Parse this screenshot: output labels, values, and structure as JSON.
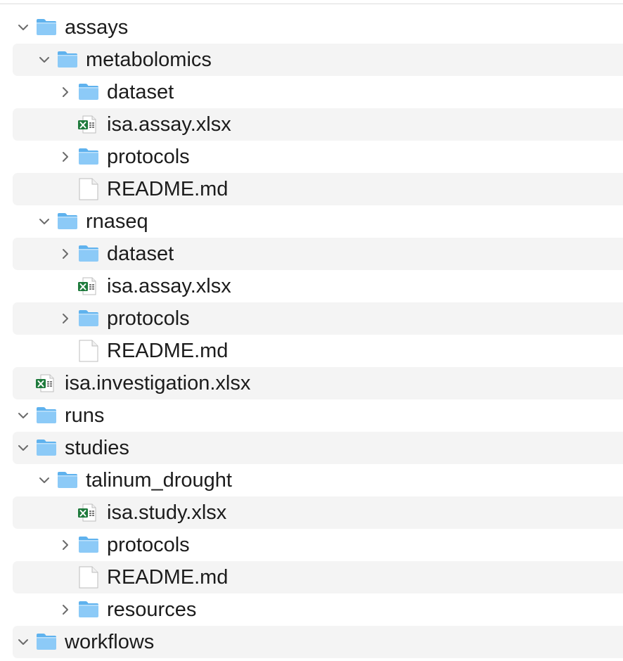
{
  "tree": {
    "rows": [
      {
        "label": "assays",
        "kind": "folder",
        "depth": 0,
        "expanded": true
      },
      {
        "label": "metabolomics",
        "kind": "folder",
        "depth": 1,
        "expanded": true
      },
      {
        "label": "dataset",
        "kind": "folder",
        "depth": 2,
        "expanded": false
      },
      {
        "label": "isa.assay.xlsx",
        "kind": "excel",
        "depth": 2
      },
      {
        "label": "protocols",
        "kind": "folder",
        "depth": 2,
        "expanded": false
      },
      {
        "label": "README.md",
        "kind": "file",
        "depth": 2
      },
      {
        "label": "rnaseq",
        "kind": "folder",
        "depth": 1,
        "expanded": true
      },
      {
        "label": "dataset",
        "kind": "folder",
        "depth": 2,
        "expanded": false
      },
      {
        "label": "isa.assay.xlsx",
        "kind": "excel",
        "depth": 2
      },
      {
        "label": "protocols",
        "kind": "folder",
        "depth": 2,
        "expanded": false
      },
      {
        "label": "README.md",
        "kind": "file",
        "depth": 2
      },
      {
        "label": "isa.investigation.xlsx",
        "kind": "excel",
        "depth": 0
      },
      {
        "label": "runs",
        "kind": "folder",
        "depth": 0,
        "expanded": true
      },
      {
        "label": "studies",
        "kind": "folder",
        "depth": 0,
        "expanded": true
      },
      {
        "label": "talinum_drought",
        "kind": "folder",
        "depth": 1,
        "expanded": true
      },
      {
        "label": "isa.study.xlsx",
        "kind": "excel",
        "depth": 2
      },
      {
        "label": "protocols",
        "kind": "folder",
        "depth": 2,
        "expanded": false
      },
      {
        "label": "README.md",
        "kind": "file",
        "depth": 2
      },
      {
        "label": "resources",
        "kind": "folder",
        "depth": 2,
        "expanded": false
      },
      {
        "label": "workflows",
        "kind": "folder",
        "depth": 0,
        "expanded": true
      }
    ]
  },
  "icons": {
    "folder": "folder-icon",
    "excel": "excel-file-icon",
    "file": "document-icon",
    "chevron_expanded": "chevron-down-icon",
    "chevron_collapsed": "chevron-right-icon"
  },
  "colors": {
    "folder_body": "#8ccaf7",
    "folder_tab": "#5fb2ee",
    "excel_green": "#1e7a3c",
    "stripe": "#f4f4f4",
    "chevron": "#6b6b6b",
    "text": "#1c1c1c"
  }
}
